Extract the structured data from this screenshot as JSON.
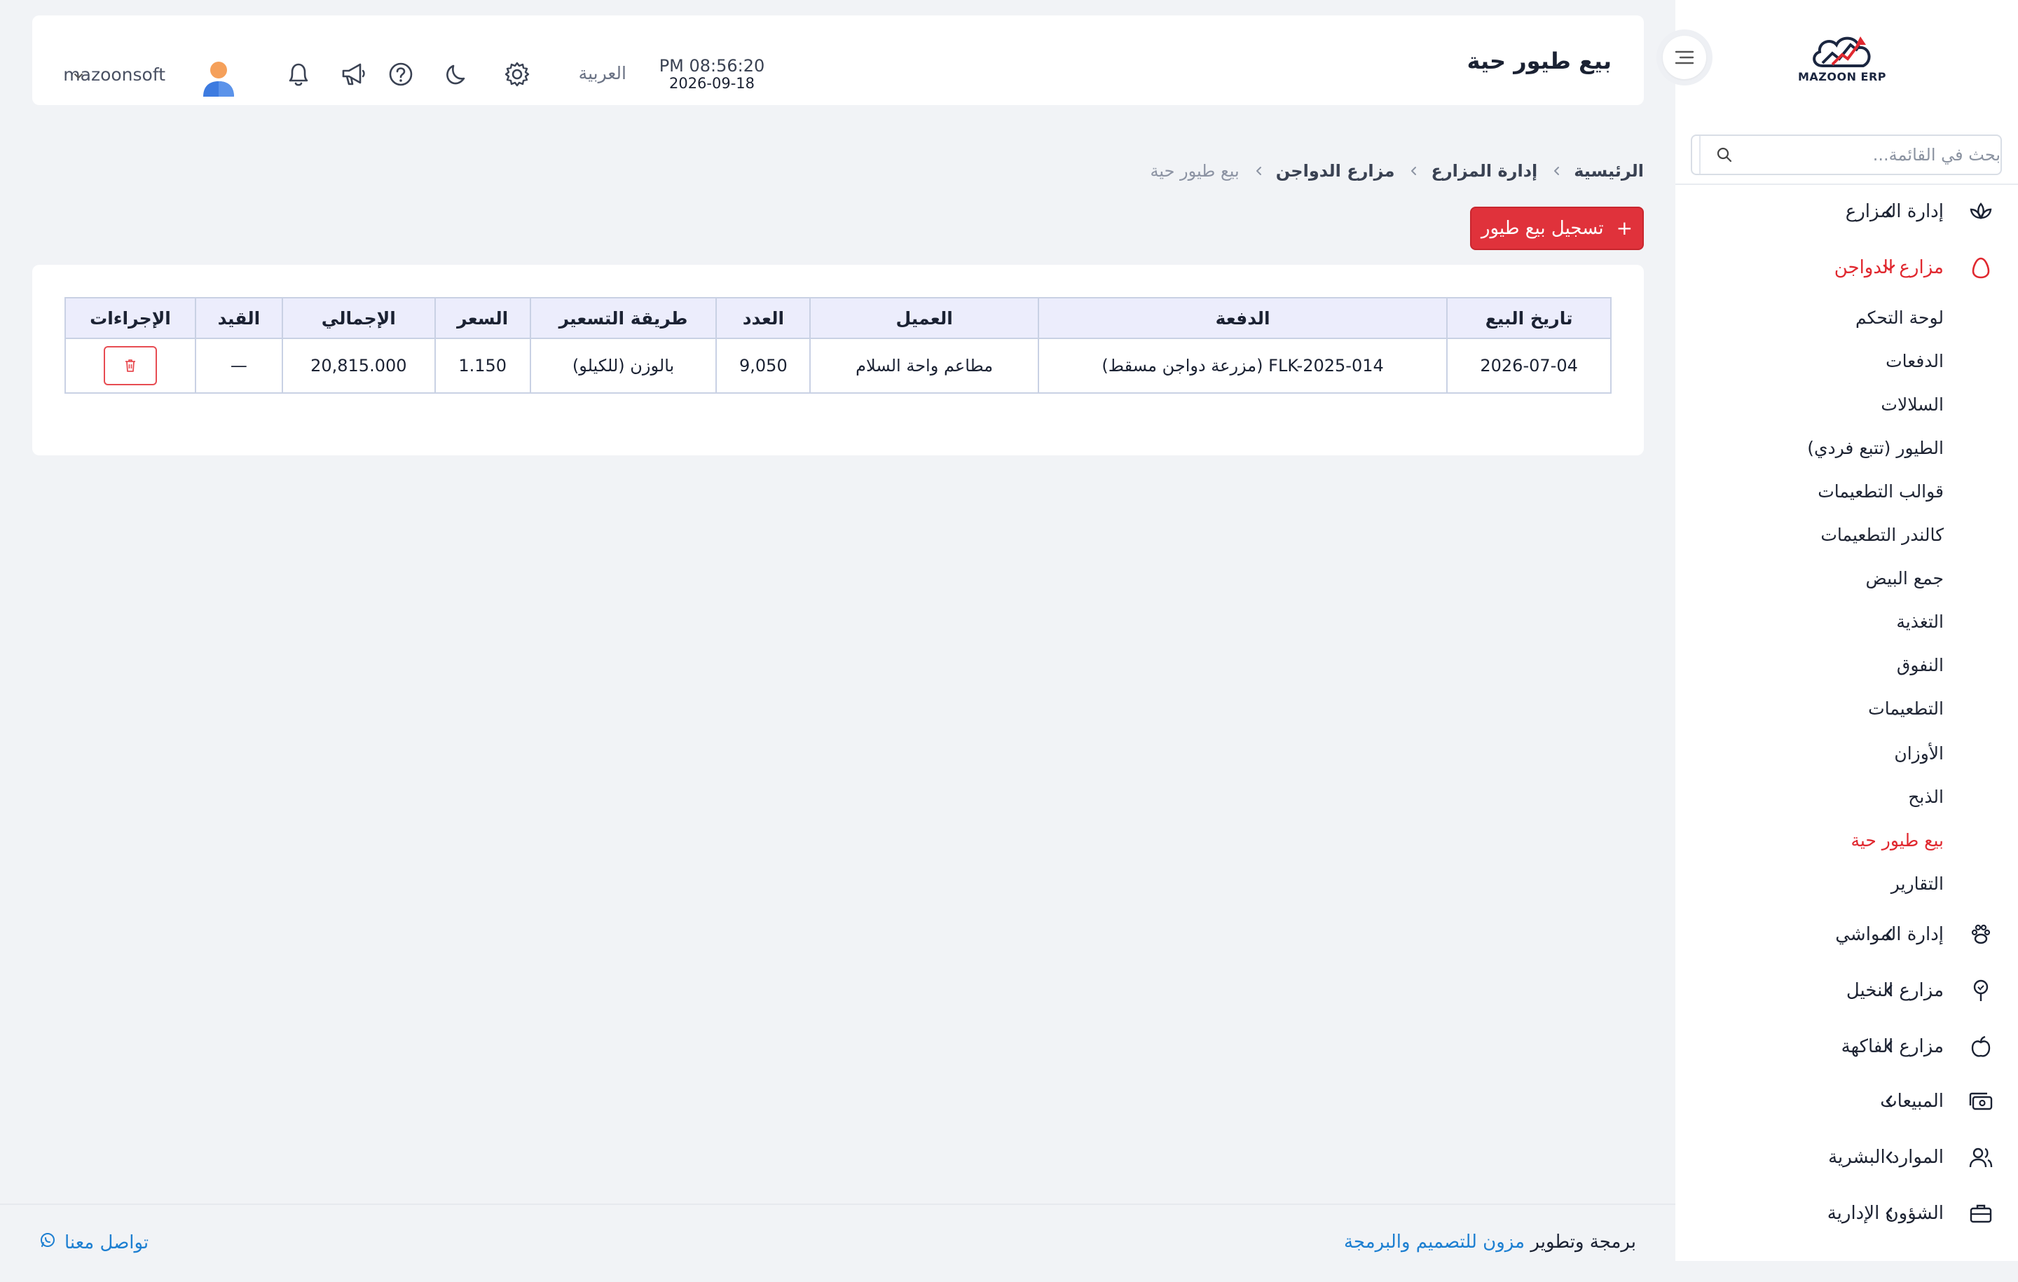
{
  "app": {
    "brand": "MAZOON ERP",
    "logo_tag": "ERP"
  },
  "colors": {
    "accent": "#e0282f",
    "link": "#1d7fd1",
    "table_header_bg": "#ecedfc"
  },
  "sidebar": {
    "search_placeholder": "بحث في القائمة...",
    "items": [
      {
        "label": "إدارة المزارع",
        "icon": "farm-plant-icon"
      },
      {
        "label": "مزارع الدواجن",
        "icon": "egg-icon"
      },
      {
        "label": "إدارة المواشي",
        "icon": "paw-icon"
      },
      {
        "label": "مزارع النخيل",
        "icon": "palm-tree-icon"
      },
      {
        "label": "مزارع الفاكهة",
        "icon": "apple-icon"
      },
      {
        "label": "المبيعات",
        "icon": "cash-icon"
      },
      {
        "label": "الموارد البشرية",
        "icon": "users-icon"
      },
      {
        "label": "الشؤون الإدارية",
        "icon": "briefcase-icon"
      }
    ],
    "poultry_sub": [
      "لوحة التحكم",
      "الدفعات",
      "السلالات",
      "الطيور (تتبع فردي)",
      "قوالب التطعيمات",
      "كالندر التطعيمات",
      "جمع البيض",
      "التغذية",
      "النفوق",
      "التطعيمات",
      "الأوزان",
      "الذبح",
      "بيع طيور حية",
      "التقارير"
    ]
  },
  "header": {
    "page_title": "بيع طيور حية",
    "time": "PM 08:56:20",
    "date": "2026-09-18",
    "language": "العربية",
    "username": "mazoonsoft"
  },
  "breadcrumb": [
    "الرئيسية",
    "إدارة المزارع",
    "مزارع الدواجن",
    "بيع طيور حية"
  ],
  "add_button": {
    "label": "تسجيل بيع طيور",
    "icon": "+"
  },
  "table": {
    "headers": [
      "تاريخ البيع",
      "الدفعة",
      "العميل",
      "العدد",
      "طريقة التسعير",
      "السعر",
      "الإجمالي",
      "القيد",
      "الإجراءات"
    ],
    "rows": [
      {
        "date": "2026-07-04",
        "batch": "FLK-2025-014 (مزرعة دواجن مسقط)",
        "customer": "مطاعم واحة السلام",
        "count": "9,050",
        "pricing": "بالوزن (للكيلو)",
        "price": "1.150",
        "total": "20,815.000",
        "entry": "—"
      }
    ]
  },
  "footer": {
    "credit_prefix": "برمجة وتطوير",
    "credit_link": "مزون للتصميم والبرمجة",
    "contact": "تواصل معنا"
  }
}
